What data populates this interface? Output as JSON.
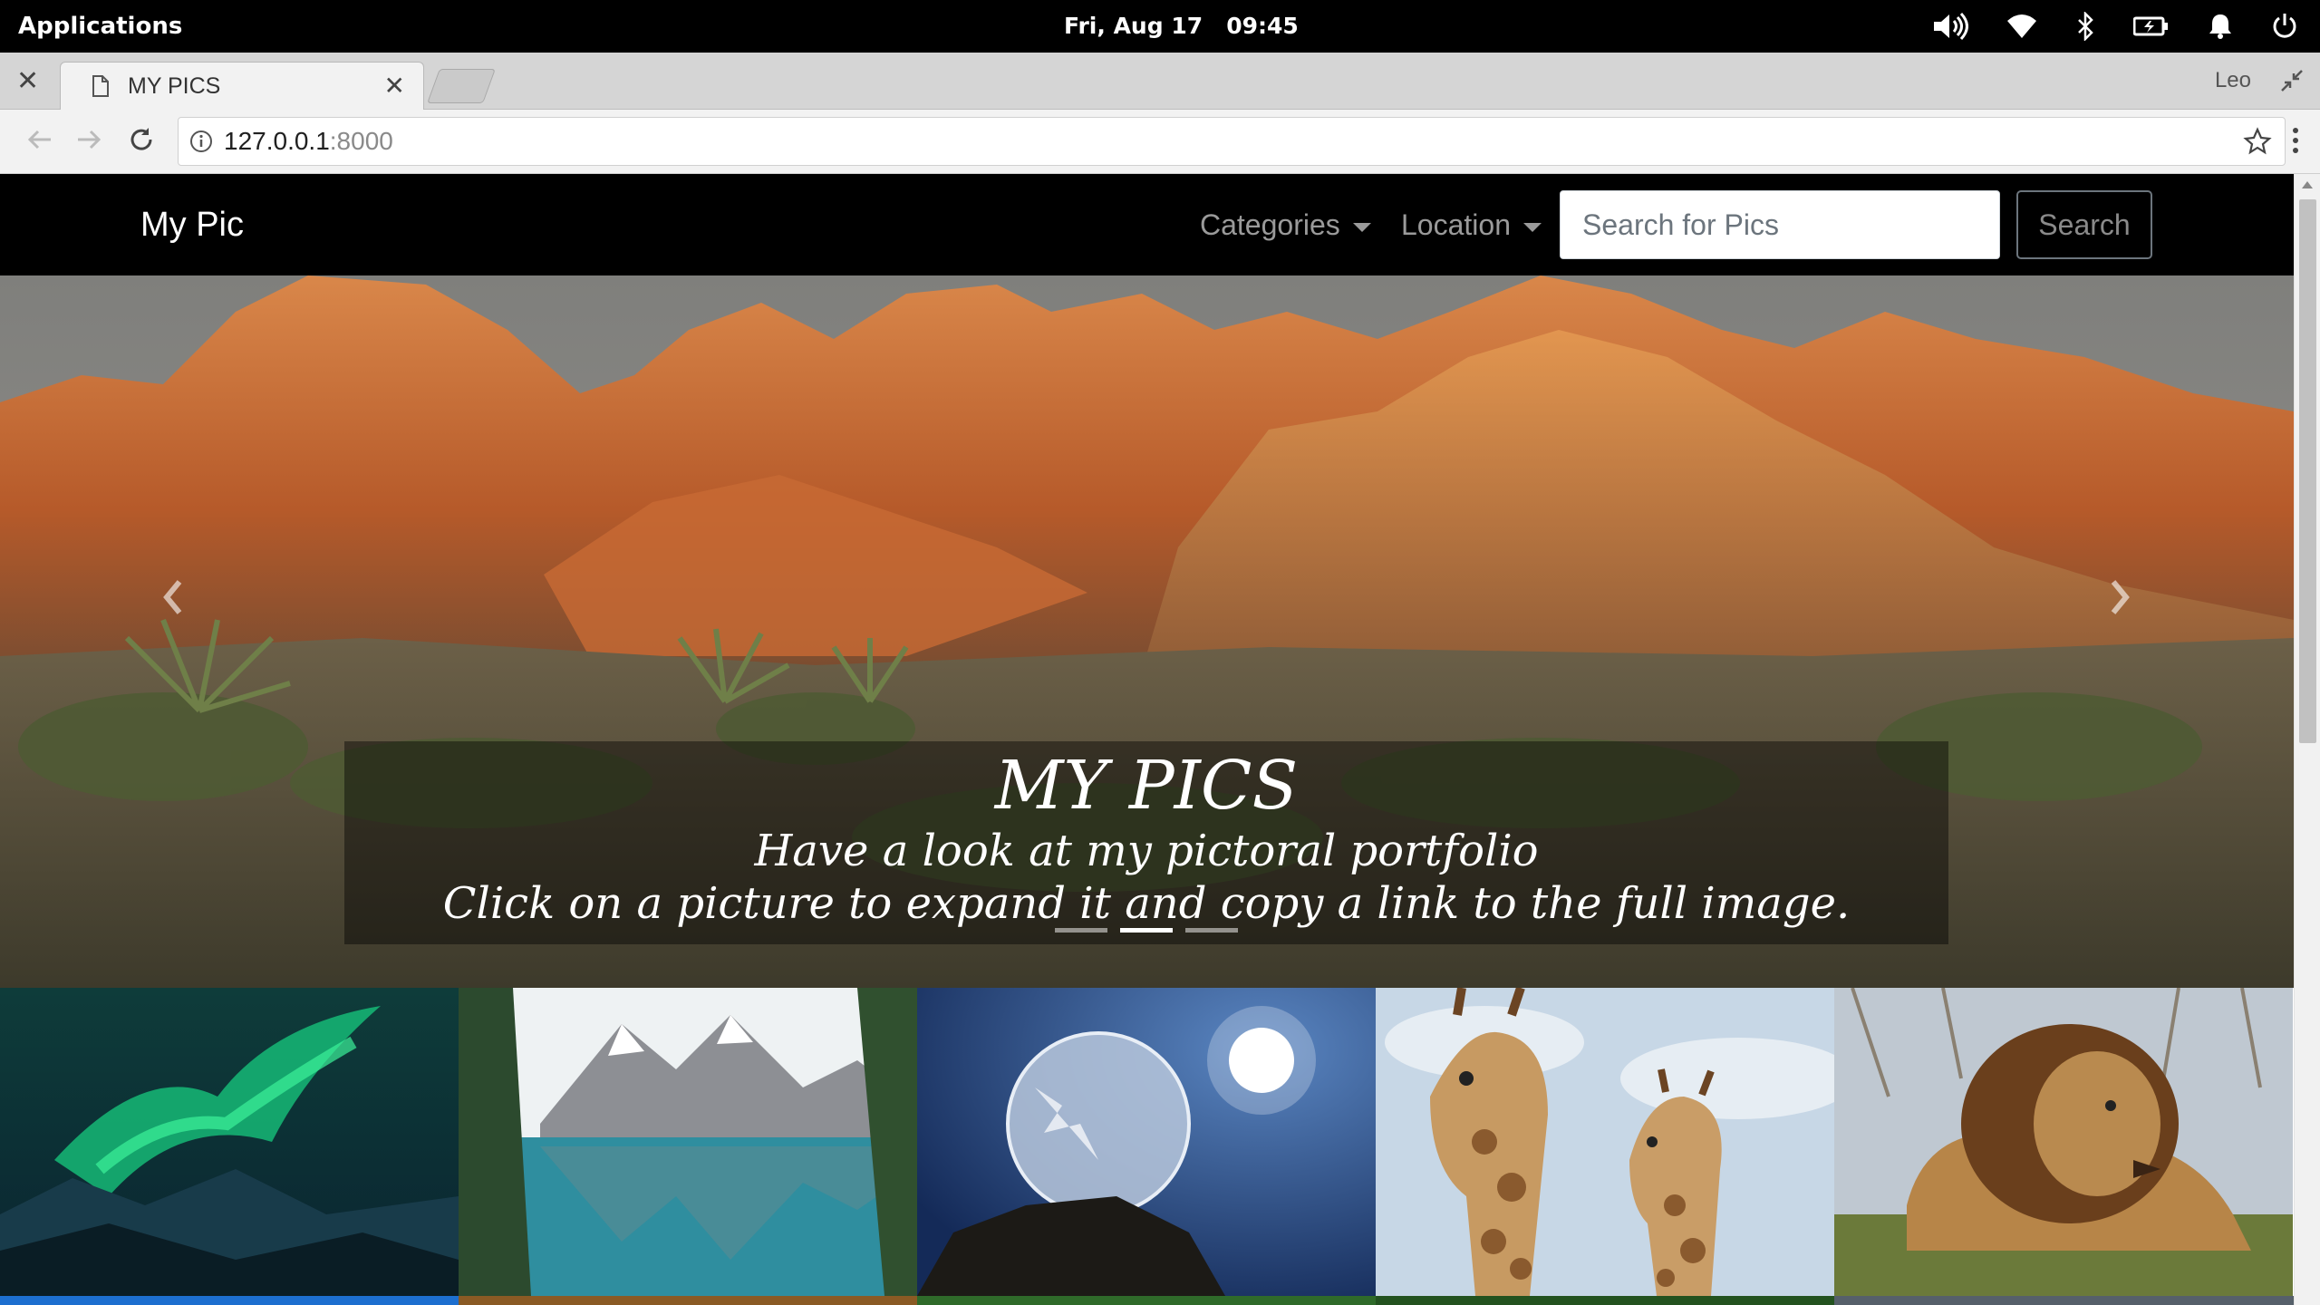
{
  "os_bar": {
    "applications_label": "Applications",
    "date": "Fri, Aug 17",
    "time": "09:45",
    "tray_icons": [
      "volume-icon",
      "wifi-icon",
      "bluetooth-icon",
      "battery-icon",
      "bell-icon",
      "power-icon"
    ]
  },
  "browser": {
    "tab_title": "MY PICS",
    "profile_name": "Leo",
    "url_host": "127.0.0.1",
    "url_port": ":8000"
  },
  "navbar": {
    "brand": "My Pic",
    "categories_label": "Categories",
    "location_label": "Location",
    "search_placeholder": "Search for Pics",
    "search_button": "Search"
  },
  "hero": {
    "title": "MY PICS",
    "line1": "Have a look at my pictoral portfolio",
    "line2": "Click on a picture to expand it and copy a link to the full image.",
    "slide_count": 3,
    "active_slide": 1
  },
  "gallery": {
    "items": [
      {
        "subject": "aurora"
      },
      {
        "subject": "mountain lake"
      },
      {
        "subject": "frozen bubble"
      },
      {
        "subject": "giraffes"
      },
      {
        "subject": "lion"
      }
    ]
  },
  "colors": {
    "navbar_bg": "#000000",
    "hero_rock": "#c8622d",
    "sky": "#8d8d8a"
  }
}
